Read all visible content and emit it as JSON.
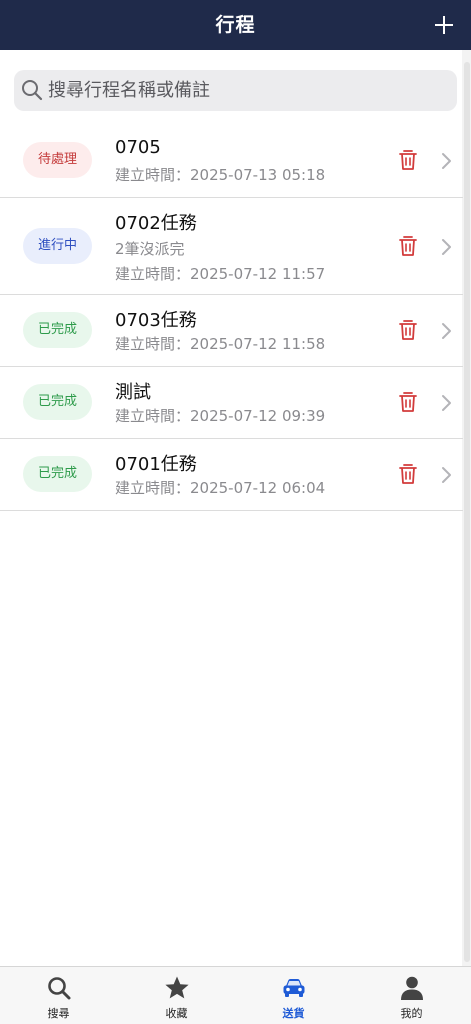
{
  "header": {
    "title": "行程",
    "add_icon": "plus-icon"
  },
  "search": {
    "placeholder": "搜尋行程名稱或備註",
    "value": "",
    "icon": "search-icon"
  },
  "trips": [
    {
      "status": "待處理",
      "status_type": "pending",
      "title": "0705",
      "note": "",
      "created": "建立時間：2025-07-13 05:18"
    },
    {
      "status": "進行中",
      "status_type": "progress",
      "title": "0702任務",
      "note": "2筆沒派完",
      "created": "建立時間：2025-07-12 11:57"
    },
    {
      "status": "已完成",
      "status_type": "done",
      "title": "0703任務",
      "note": "",
      "created": "建立時間：2025-07-12 11:58"
    },
    {
      "status": "已完成",
      "status_type": "done",
      "title": "測試",
      "note": "",
      "created": "建立時間：2025-07-12 09:39"
    },
    {
      "status": "已完成",
      "status_type": "done",
      "title": "0701任務",
      "note": "",
      "created": "建立時間：2025-07-12 06:04"
    }
  ],
  "tabbar": {
    "tabs": [
      {
        "label": "搜尋",
        "icon": "search-icon",
        "active": false
      },
      {
        "label": "收藏",
        "icon": "star-icon",
        "active": false
      },
      {
        "label": "送貨",
        "icon": "car-icon",
        "active": true
      },
      {
        "label": "我的",
        "icon": "person-icon",
        "active": false
      }
    ]
  },
  "colors": {
    "header_bg": "#1f2a4a",
    "pending": "#c43a3a",
    "progress": "#2f4fc0",
    "done": "#2e9b4b",
    "trash": "#d23b3b",
    "tab_active": "#1f5bd6"
  }
}
